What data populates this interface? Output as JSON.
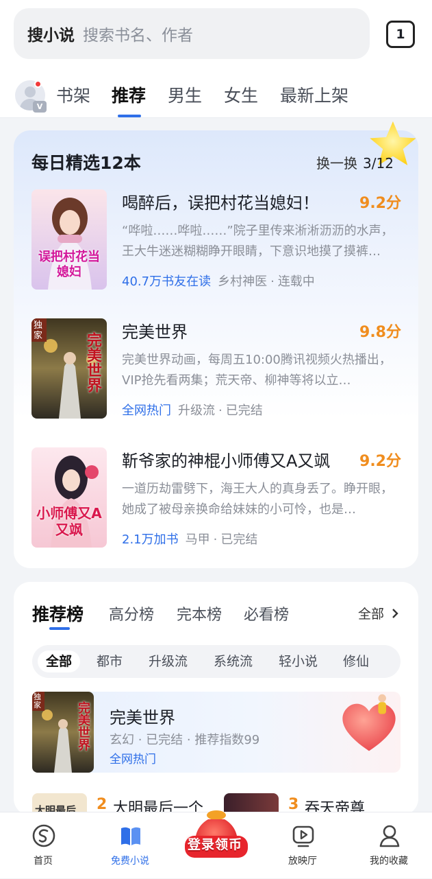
{
  "search": {
    "brand": "搜小说",
    "placeholder": "搜索书名、作者",
    "tab_count": "1"
  },
  "avatar": {
    "badge": "V"
  },
  "nav": {
    "tabs": [
      "书架",
      "推荐",
      "男生",
      "女生",
      "最新上架"
    ],
    "active": "推荐"
  },
  "daily": {
    "title": "每日精选12本",
    "refresh": "换一换",
    "page": "3/12",
    "books": [
      {
        "title": "喝醉后，误把村花当媳妇！",
        "score": "9.2分",
        "desc": "“哗啦……哗啦……”院子里传来淅淅沥沥的水声，王大牛迷迷糊糊睁开眼睛，下意识地摸了摸裤…",
        "highlight": "40.7万书友在读",
        "tags": [
          "乡村神医",
          "连载中"
        ],
        "cover_text": "误把村花当媳妇"
      },
      {
        "title": "完美世界",
        "score": "9.8分",
        "desc": "完美世界动画，每周五10:00腾讯视频火热播出，VIP抢先看两集；荒天帝、柳神等将以立…",
        "highlight": "全网热门",
        "tags": [
          "升级流",
          "已完结"
        ],
        "cover_text": "完美世界"
      },
      {
        "title": "靳爷家的神棍小师傅又A又飒",
        "score": "9.2分",
        "desc": "一道历劫雷劈下，海王大人的真身丢了。睁开眼，她成了被母亲换命给妹妹的小可怜，也是…",
        "highlight": "2.1万加书",
        "tags": [
          "马甲",
          "已完结"
        ],
        "cover_text": "小师傅又A又飒"
      }
    ]
  },
  "rank": {
    "tabs": [
      "推荐榜",
      "高分榜",
      "完本榜",
      "必看榜"
    ],
    "all": "全部",
    "chips": [
      "全部",
      "都市",
      "升级流",
      "系统流",
      "轻小说",
      "修仙"
    ],
    "top_book": {
      "title": "完美世界",
      "meta": "玄幻 · 已完结 · 推荐指数99",
      "tag": "全网热门"
    },
    "next": [
      {
        "num": "2",
        "title": "大明最后一个"
      },
      {
        "num": "3",
        "title": "吞天帝尊"
      }
    ]
  },
  "tabbar": {
    "items": [
      {
        "label": "首页",
        "icon": "home-s-icon"
      },
      {
        "label": "免费小说",
        "icon": "book-icon"
      },
      {
        "label": "登录领币",
        "icon": "coin-bag-icon"
      },
      {
        "label": "放映厅",
        "icon": "play-icon"
      },
      {
        "label": "我的收藏",
        "icon": "person-icon"
      }
    ]
  },
  "colors": {
    "accent": "#2f6fe8",
    "score": "#f08d1e",
    "login": "#e72c2c"
  }
}
